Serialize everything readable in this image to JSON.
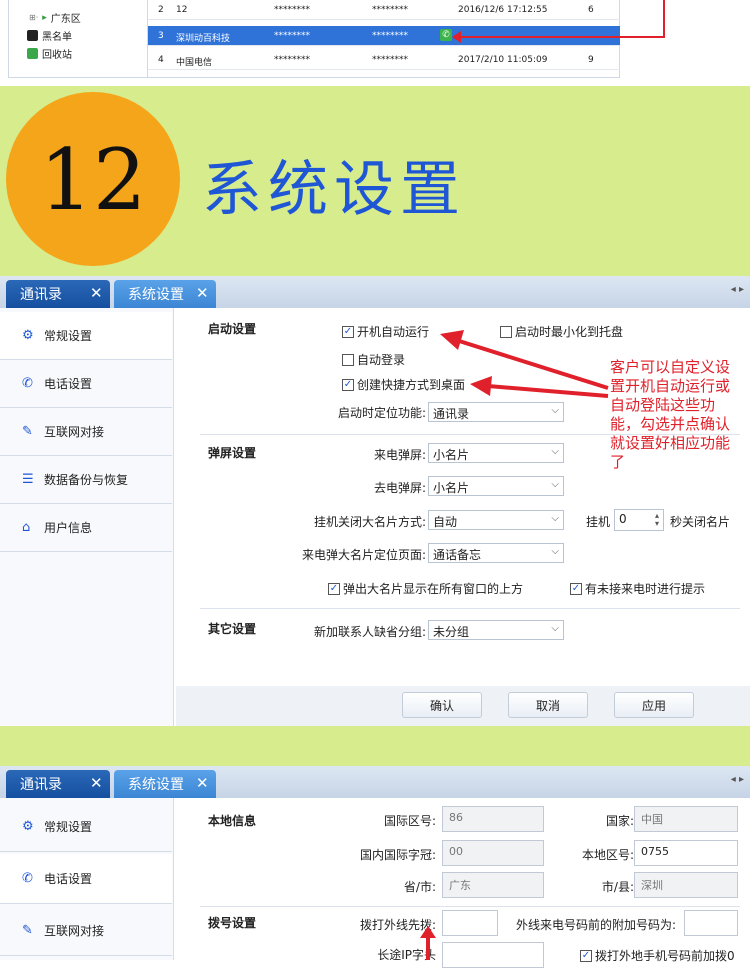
{
  "top_table": {
    "tree": [
      {
        "label": "广东区"
      },
      {
        "label": "黑名单"
      },
      {
        "label": "回收站"
      }
    ],
    "rows": [
      {
        "no": "2",
        "name": "12",
        "c1": "********",
        "c2": "********",
        "time": "2016/12/6  17:12:55",
        "count": "6",
        "selected": false
      },
      {
        "no": "3",
        "name": "深圳动百科技",
        "c1": "********",
        "c2": "********",
        "time": "",
        "count": "",
        "selected": true
      },
      {
        "no": "4",
        "name": "中国电信",
        "c1": "********",
        "c2": "********",
        "time": "2017/2/10  11:05:09",
        "count": "9",
        "selected": false
      }
    ]
  },
  "banner": {
    "number": "12",
    "title": "系统设置"
  },
  "window1": {
    "tabs": [
      {
        "label": "通讯录"
      },
      {
        "label": "系统设置"
      }
    ],
    "sidebar": [
      {
        "label": "常规设置",
        "icon": "gear-icon"
      },
      {
        "label": "电话设置",
        "icon": "phone-icon"
      },
      {
        "label": "互联网对接",
        "icon": "pencil-icon"
      },
      {
        "label": "数据备份与恢复",
        "icon": "backup-icon"
      },
      {
        "label": "用户信息",
        "icon": "home-icon"
      }
    ],
    "startup": {
      "title": "启动设置",
      "auto_run": "开机自动运行",
      "minimize": "启动时最小化到托盘",
      "auto_login": "自动登录",
      "shortcut": "创建快捷方式到桌面",
      "locate_label": "启动时定位功能:",
      "locate_value": "通讯录"
    },
    "popup": {
      "title": "弹屏设置",
      "incoming_label": "来电弹屏:",
      "incoming_value": "小名片",
      "outgoing_label": "去电弹屏:",
      "outgoing_value": "小名片",
      "hangup_label": "挂机关闭大名片方式:",
      "hangup_value": "自动",
      "hangup_prefix": "挂机",
      "hangup_seconds": "0",
      "hangup_suffix": "秒关闭名片",
      "big_card_label": "来电弹大名片定位页面:",
      "big_card_value": "通话备忘",
      "on_top": "弹出大名片显示在所有窗口的上方",
      "missed": "有未接来电时进行提示"
    },
    "other": {
      "title": "其它设置",
      "group_label": "新加联系人缺省分组:",
      "group_value": "未分组"
    },
    "buttons": {
      "ok": "确认",
      "cancel": "取消",
      "apply": "应用"
    },
    "annotation": "客户可以自定义设置开机自动运行或自动登陆这些功能，勾选并点确认就设置好相应功能了"
  },
  "window2": {
    "tabs": [
      {
        "label": "通讯录"
      },
      {
        "label": "系统设置"
      }
    ],
    "sidebar": [
      {
        "label": "常规设置",
        "icon": "gear-icon"
      },
      {
        "label": "电话设置",
        "icon": "phone-icon"
      },
      {
        "label": "互联网对接",
        "icon": "pencil-icon"
      }
    ],
    "local": {
      "title": "本地信息",
      "country_code_label": "国际区号:",
      "country_code": "86",
      "country_label": "国家:",
      "country": "中国",
      "intl_prefix_label": "国内国际字冠:",
      "intl_prefix": "00",
      "area_label": "本地区号:",
      "area": "0755",
      "province_label": "省/市:",
      "province": "广东",
      "city_label": "市/县:",
      "city": "深圳"
    },
    "dial": {
      "title": "拨号设置",
      "outline_label": "拨打外线先拨:",
      "outline": "",
      "extra_label": "外线来电号码前的附加号码为:",
      "extra": "",
      "ip_label": "长途IP字头",
      "mobile": "拨打外地手机号码前加拨0"
    }
  }
}
